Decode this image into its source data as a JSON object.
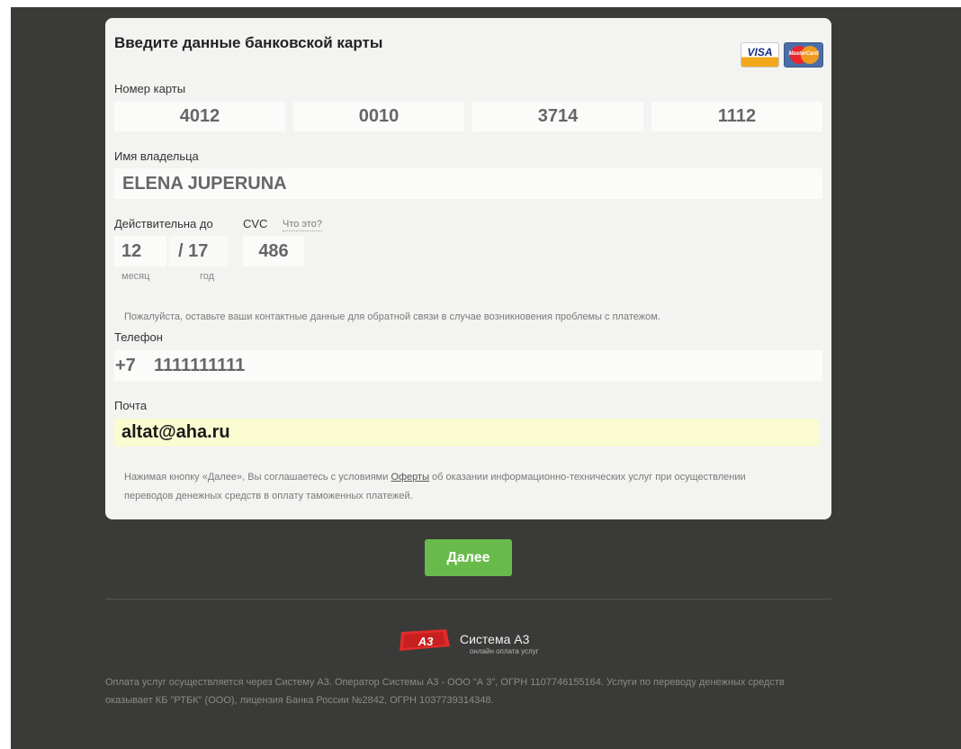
{
  "form": {
    "title": "Введите данные банковской карты",
    "logos": {
      "visa": "VISA",
      "mastercard": "MasterCard"
    },
    "card_number": {
      "label": "Номер карты",
      "segments": [
        "4012",
        "0010",
        "3714",
        "1112"
      ]
    },
    "holder": {
      "label": "Имя владельца",
      "value": "ELENA JUPERUNA"
    },
    "expiry": {
      "label": "Действительна до",
      "month": "12",
      "separator": "/",
      "year": "17",
      "month_caption": "месяц",
      "year_caption": "год"
    },
    "cvc": {
      "label": "CVC",
      "help_link": "Что это?",
      "value": "486"
    },
    "contact_note": "Пожалуйста, оставьте ваши контактные данные для обратной связи в случае возникновения проблемы с платежом.",
    "phone": {
      "label": "Телефон",
      "prefix": "+7",
      "value": "1111111111"
    },
    "email": {
      "label": "Почта",
      "value": "altat@aha.ru"
    },
    "legal": {
      "before": "Нажимая кнопку «Далее», Вы соглашаетесь с условиями ",
      "link": "Оферты",
      "after": " об оказании информационно-технических услуг при осуществлении переводов денежных средств в оплату таможенных платежей."
    }
  },
  "next_button": "Далее",
  "footer": {
    "brand_logo_text": "А3",
    "brand_name": "Система А3",
    "brand_tagline": "онлайн оплата услуг",
    "text": "Оплата услуг осуществляется через Систему А3. Оператор Системы А3 - ООО \"А 3\", ОГРН 1107746155164. Услуги по переводу денежных средств оказывает КБ \"РТБК\" (ООО), лицензия Банка России №2842, ОГРН 1037739314348."
  },
  "colors": {
    "background": "#3a3a38",
    "card": "#f3f3f1",
    "button": "#68bb4b",
    "email_highlight": "#fafbd0",
    "brand_red": "#e02b2b"
  }
}
